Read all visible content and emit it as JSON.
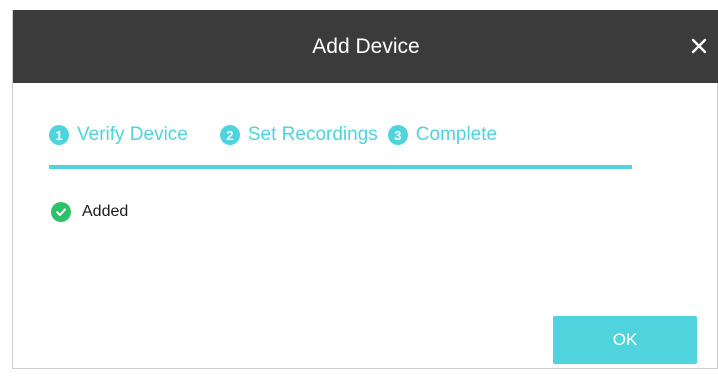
{
  "dialog": {
    "title": "Add Device",
    "close_icon": "close-icon"
  },
  "steps": [
    {
      "number": "1",
      "label": "Verify Device"
    },
    {
      "number": "2",
      "label": "Set Recordings"
    },
    {
      "number": "3",
      "label": "Complete"
    }
  ],
  "status": {
    "icon": "check-circle-icon",
    "text": "Added"
  },
  "buttons": {
    "ok_label": "OK"
  },
  "colors": {
    "accent": "#4fd3dc",
    "titlebar": "#3b3b3b",
    "success": "#2fc06a"
  }
}
